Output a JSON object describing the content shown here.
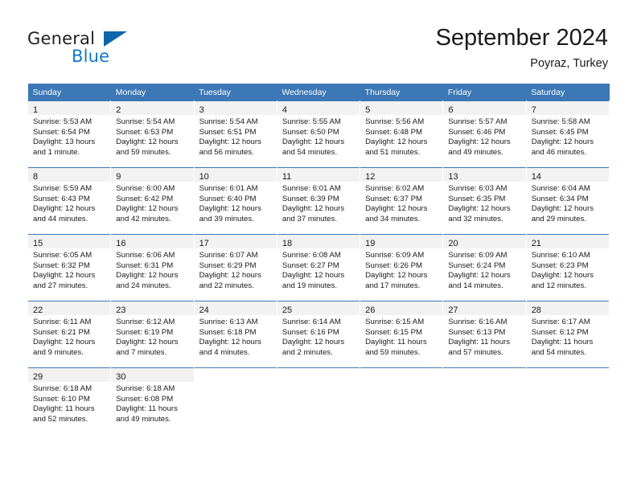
{
  "brand": {
    "name_part1": "General",
    "name_part2": "Blue",
    "triangle_color": "#1065a8",
    "blue_color": "#1278c8"
  },
  "header": {
    "title": "September 2024",
    "subtitle": "Poyraz, Turkey"
  },
  "theme": {
    "header_row_bg": "#3b78b5",
    "daynum_band_bg": "#f2f2f2",
    "grid_line": "#3b78b5",
    "text": "#1a1a1a"
  },
  "weekday_headers": [
    "Sunday",
    "Monday",
    "Tuesday",
    "Wednesday",
    "Thursday",
    "Friday",
    "Saturday"
  ],
  "weeks": [
    [
      {
        "day": "1",
        "sunrise": "Sunrise: 5:53 AM",
        "sunset": "Sunset: 6:54 PM",
        "daylight1": "Daylight: 13 hours",
        "daylight2": "and 1 minute."
      },
      {
        "day": "2",
        "sunrise": "Sunrise: 5:54 AM",
        "sunset": "Sunset: 6:53 PM",
        "daylight1": "Daylight: 12 hours",
        "daylight2": "and 59 minutes."
      },
      {
        "day": "3",
        "sunrise": "Sunrise: 5:54 AM",
        "sunset": "Sunset: 6:51 PM",
        "daylight1": "Daylight: 12 hours",
        "daylight2": "and 56 minutes."
      },
      {
        "day": "4",
        "sunrise": "Sunrise: 5:55 AM",
        "sunset": "Sunset: 6:50 PM",
        "daylight1": "Daylight: 12 hours",
        "daylight2": "and 54 minutes."
      },
      {
        "day": "5",
        "sunrise": "Sunrise: 5:56 AM",
        "sunset": "Sunset: 6:48 PM",
        "daylight1": "Daylight: 12 hours",
        "daylight2": "and 51 minutes."
      },
      {
        "day": "6",
        "sunrise": "Sunrise: 5:57 AM",
        "sunset": "Sunset: 6:46 PM",
        "daylight1": "Daylight: 12 hours",
        "daylight2": "and 49 minutes."
      },
      {
        "day": "7",
        "sunrise": "Sunrise: 5:58 AM",
        "sunset": "Sunset: 6:45 PM",
        "daylight1": "Daylight: 12 hours",
        "daylight2": "and 46 minutes."
      }
    ],
    [
      {
        "day": "8",
        "sunrise": "Sunrise: 5:59 AM",
        "sunset": "Sunset: 6:43 PM",
        "daylight1": "Daylight: 12 hours",
        "daylight2": "and 44 minutes."
      },
      {
        "day": "9",
        "sunrise": "Sunrise: 6:00 AM",
        "sunset": "Sunset: 6:42 PM",
        "daylight1": "Daylight: 12 hours",
        "daylight2": "and 42 minutes."
      },
      {
        "day": "10",
        "sunrise": "Sunrise: 6:01 AM",
        "sunset": "Sunset: 6:40 PM",
        "daylight1": "Daylight: 12 hours",
        "daylight2": "and 39 minutes."
      },
      {
        "day": "11",
        "sunrise": "Sunrise: 6:01 AM",
        "sunset": "Sunset: 6:39 PM",
        "daylight1": "Daylight: 12 hours",
        "daylight2": "and 37 minutes."
      },
      {
        "day": "12",
        "sunrise": "Sunrise: 6:02 AM",
        "sunset": "Sunset: 6:37 PM",
        "daylight1": "Daylight: 12 hours",
        "daylight2": "and 34 minutes."
      },
      {
        "day": "13",
        "sunrise": "Sunrise: 6:03 AM",
        "sunset": "Sunset: 6:35 PM",
        "daylight1": "Daylight: 12 hours",
        "daylight2": "and 32 minutes."
      },
      {
        "day": "14",
        "sunrise": "Sunrise: 6:04 AM",
        "sunset": "Sunset: 6:34 PM",
        "daylight1": "Daylight: 12 hours",
        "daylight2": "and 29 minutes."
      }
    ],
    [
      {
        "day": "15",
        "sunrise": "Sunrise: 6:05 AM",
        "sunset": "Sunset: 6:32 PM",
        "daylight1": "Daylight: 12 hours",
        "daylight2": "and 27 minutes."
      },
      {
        "day": "16",
        "sunrise": "Sunrise: 6:06 AM",
        "sunset": "Sunset: 6:31 PM",
        "daylight1": "Daylight: 12 hours",
        "daylight2": "and 24 minutes."
      },
      {
        "day": "17",
        "sunrise": "Sunrise: 6:07 AM",
        "sunset": "Sunset: 6:29 PM",
        "daylight1": "Daylight: 12 hours",
        "daylight2": "and 22 minutes."
      },
      {
        "day": "18",
        "sunrise": "Sunrise: 6:08 AM",
        "sunset": "Sunset: 6:27 PM",
        "daylight1": "Daylight: 12 hours",
        "daylight2": "and 19 minutes."
      },
      {
        "day": "19",
        "sunrise": "Sunrise: 6:09 AM",
        "sunset": "Sunset: 6:26 PM",
        "daylight1": "Daylight: 12 hours",
        "daylight2": "and 17 minutes."
      },
      {
        "day": "20",
        "sunrise": "Sunrise: 6:09 AM",
        "sunset": "Sunset: 6:24 PM",
        "daylight1": "Daylight: 12 hours",
        "daylight2": "and 14 minutes."
      },
      {
        "day": "21",
        "sunrise": "Sunrise: 6:10 AM",
        "sunset": "Sunset: 6:23 PM",
        "daylight1": "Daylight: 12 hours",
        "daylight2": "and 12 minutes."
      }
    ],
    [
      {
        "day": "22",
        "sunrise": "Sunrise: 6:11 AM",
        "sunset": "Sunset: 6:21 PM",
        "daylight1": "Daylight: 12 hours",
        "daylight2": "and 9 minutes."
      },
      {
        "day": "23",
        "sunrise": "Sunrise: 6:12 AM",
        "sunset": "Sunset: 6:19 PM",
        "daylight1": "Daylight: 12 hours",
        "daylight2": "and 7 minutes."
      },
      {
        "day": "24",
        "sunrise": "Sunrise: 6:13 AM",
        "sunset": "Sunset: 6:18 PM",
        "daylight1": "Daylight: 12 hours",
        "daylight2": "and 4 minutes."
      },
      {
        "day": "25",
        "sunrise": "Sunrise: 6:14 AM",
        "sunset": "Sunset: 6:16 PM",
        "daylight1": "Daylight: 12 hours",
        "daylight2": "and 2 minutes."
      },
      {
        "day": "26",
        "sunrise": "Sunrise: 6:15 AM",
        "sunset": "Sunset: 6:15 PM",
        "daylight1": "Daylight: 11 hours",
        "daylight2": "and 59 minutes."
      },
      {
        "day": "27",
        "sunrise": "Sunrise: 6:16 AM",
        "sunset": "Sunset: 6:13 PM",
        "daylight1": "Daylight: 11 hours",
        "daylight2": "and 57 minutes."
      },
      {
        "day": "28",
        "sunrise": "Sunrise: 6:17 AM",
        "sunset": "Sunset: 6:12 PM",
        "daylight1": "Daylight: 11 hours",
        "daylight2": "and 54 minutes."
      }
    ],
    [
      {
        "day": "29",
        "sunrise": "Sunrise: 6:18 AM",
        "sunset": "Sunset: 6:10 PM",
        "daylight1": "Daylight: 11 hours",
        "daylight2": "and 52 minutes."
      },
      {
        "day": "30",
        "sunrise": "Sunrise: 6:18 AM",
        "sunset": "Sunset: 6:08 PM",
        "daylight1": "Daylight: 11 hours",
        "daylight2": "and 49 minutes."
      },
      {
        "day": "",
        "sunrise": "",
        "sunset": "",
        "daylight1": "",
        "daylight2": ""
      },
      {
        "day": "",
        "sunrise": "",
        "sunset": "",
        "daylight1": "",
        "daylight2": ""
      },
      {
        "day": "",
        "sunrise": "",
        "sunset": "",
        "daylight1": "",
        "daylight2": ""
      },
      {
        "day": "",
        "sunrise": "",
        "sunset": "",
        "daylight1": "",
        "daylight2": ""
      },
      {
        "day": "",
        "sunrise": "",
        "sunset": "",
        "daylight1": "",
        "daylight2": ""
      }
    ]
  ]
}
